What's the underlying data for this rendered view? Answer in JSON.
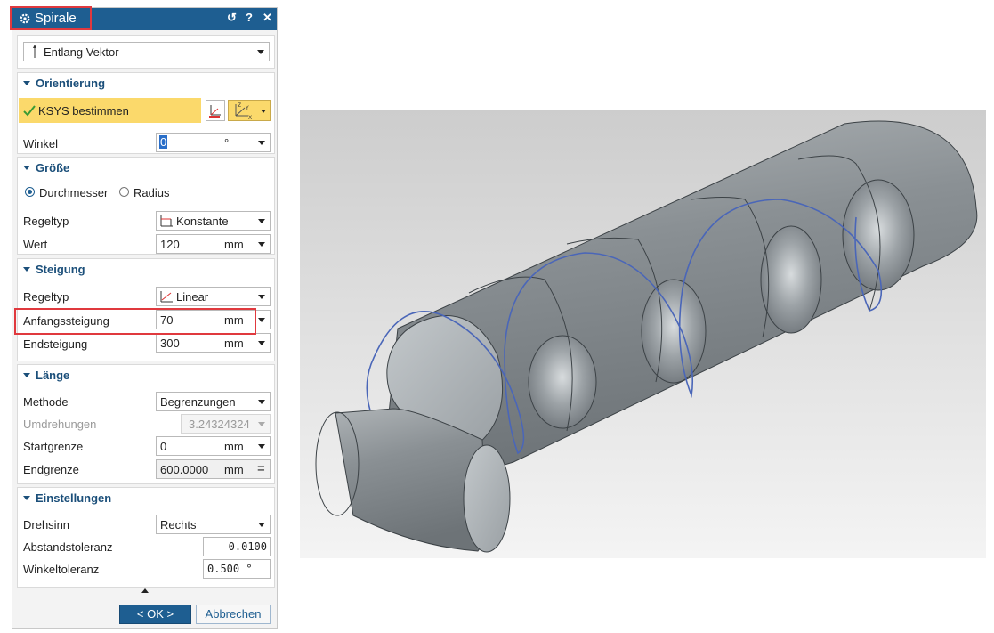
{
  "dialog": {
    "title": "Spirale",
    "title_buttons": {
      "reset": "↺",
      "help": "?",
      "close": "✕"
    },
    "type_select": "Entlang Vektor",
    "orientation": {
      "header": "Orientierung",
      "csys_label": "KSYS bestimmen",
      "angle_label": "Winkel",
      "angle_value": "0",
      "angle_unit": "°"
    },
    "size": {
      "header": "Größe",
      "radio_diameter": "Durchmesser",
      "radio_radius": "Radius",
      "selected": "Durchmesser",
      "rule_label": "Regeltyp",
      "rule_value": "Konstante",
      "value_label": "Wert",
      "value": "120",
      "unit": "mm"
    },
    "pitch": {
      "header": "Steigung",
      "rule_label": "Regeltyp",
      "rule_value": "Linear",
      "start_label": "Anfangssteigung",
      "start_value": "70",
      "end_label": "Endsteigung",
      "end_value": "300",
      "unit": "mm"
    },
    "length": {
      "header": "Länge",
      "method_label": "Methode",
      "method_value": "Begrenzungen",
      "turns_label": "Umdrehungen",
      "turns_value": "3.24324324",
      "start_label": "Startgrenze",
      "start_value": "0",
      "end_label": "Endgrenze",
      "end_value": "600.0000",
      "end_suffix": "=",
      "unit": "mm"
    },
    "settings": {
      "header": "Einstellungen",
      "direction_label": "Drehsinn",
      "direction_value": "Rechts",
      "dist_tol_label": "Abstandstoleranz",
      "dist_tol_value": "0.0100",
      "angle_tol_label": "Winkeltoleranz",
      "angle_tol_value": "0.500 °"
    },
    "ok_label": "< OK >",
    "cancel_label": "Abbrechen"
  },
  "colors": {
    "titlebar": "#1e5e91",
    "highlight": "#e0393e",
    "section_header": "#1b4f7a",
    "csys_row": "#fbd96b",
    "helix": "#4a66b8",
    "ok_button": "#1e5e91"
  }
}
